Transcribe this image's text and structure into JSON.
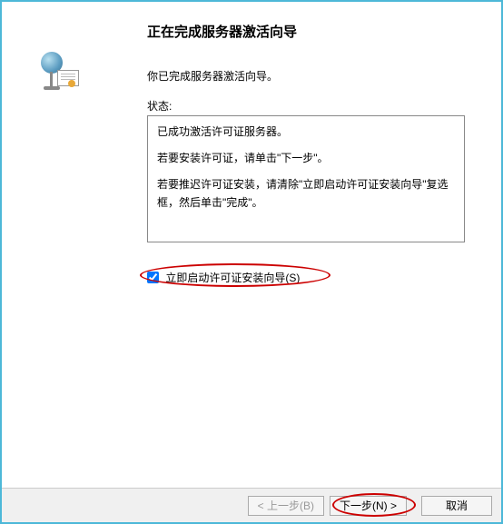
{
  "wizard": {
    "title": "正在完成服务器激活向导",
    "subtitle": "你已完成服务器激活向导。",
    "status_label": "状态:",
    "status_lines": {
      "l1": "已成功激活许可证服务器。",
      "l2": "若要安装许可证，请单击\"下一步\"。",
      "l3": "若要推迟许可证安装，请清除\"立即启动许可证安装向导\"复选框，然后单击\"完成\"。"
    },
    "checkbox": {
      "label": "立即启动许可证安装向导(S)",
      "checked": true
    }
  },
  "buttons": {
    "back": "< 上一步(B)",
    "next": "下一步(N) >",
    "cancel": "取消"
  }
}
